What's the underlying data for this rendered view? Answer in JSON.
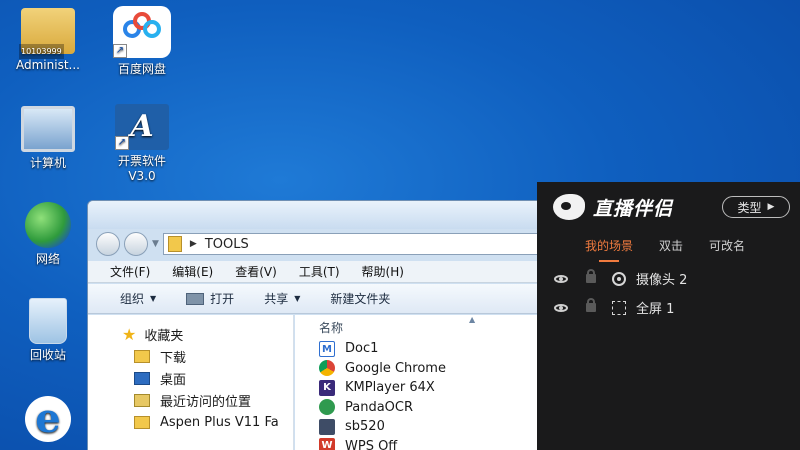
{
  "desktop": {
    "icons": [
      {
        "label": "Administ...",
        "badge": "10103999",
        "icon": "user-folder-icon"
      },
      {
        "label": "百度网盘",
        "icon": "baidu-netdisk-icon"
      },
      {
        "label": "计算机",
        "icon": "computer-icon"
      },
      {
        "label": "开票软件\nV3.0",
        "label_line1": "开票软件",
        "label_line2": "V3.0",
        "icon": "invoice-software-icon"
      },
      {
        "label": "网络",
        "icon": "network-icon"
      },
      {
        "label": "回收站",
        "icon": "recycle-bin-icon"
      },
      {
        "label": "",
        "icon": "internet-explorer-icon"
      }
    ]
  },
  "explorer": {
    "address": "TOOLS",
    "menu": [
      "文件(F)",
      "编辑(E)",
      "查看(V)",
      "工具(T)",
      "帮助(H)"
    ],
    "toolbar": [
      "组织",
      "打开",
      "共享",
      "新建文件夹"
    ],
    "nav": {
      "favorites": "收藏夹",
      "items": [
        "下载",
        "桌面",
        "最近访问的位置",
        "Aspen Plus V11 Fa"
      ]
    },
    "column_name": "名称",
    "files": [
      "Doc1",
      "Google Chrome",
      "KMPlayer 64X",
      "PandaOCR",
      "sb520",
      "WPS Off"
    ]
  },
  "stream": {
    "brand": "直播伴侣",
    "type_button": "类型",
    "tabs": [
      "我的场景",
      "双击",
      "可改名"
    ],
    "scenes": [
      "摄像头 2",
      "全屏 1"
    ]
  },
  "colors": {
    "desktop_blue": "#0f5fbf",
    "panel_bg": "#1a1a1b",
    "accent_orange": "#f07b3f"
  }
}
